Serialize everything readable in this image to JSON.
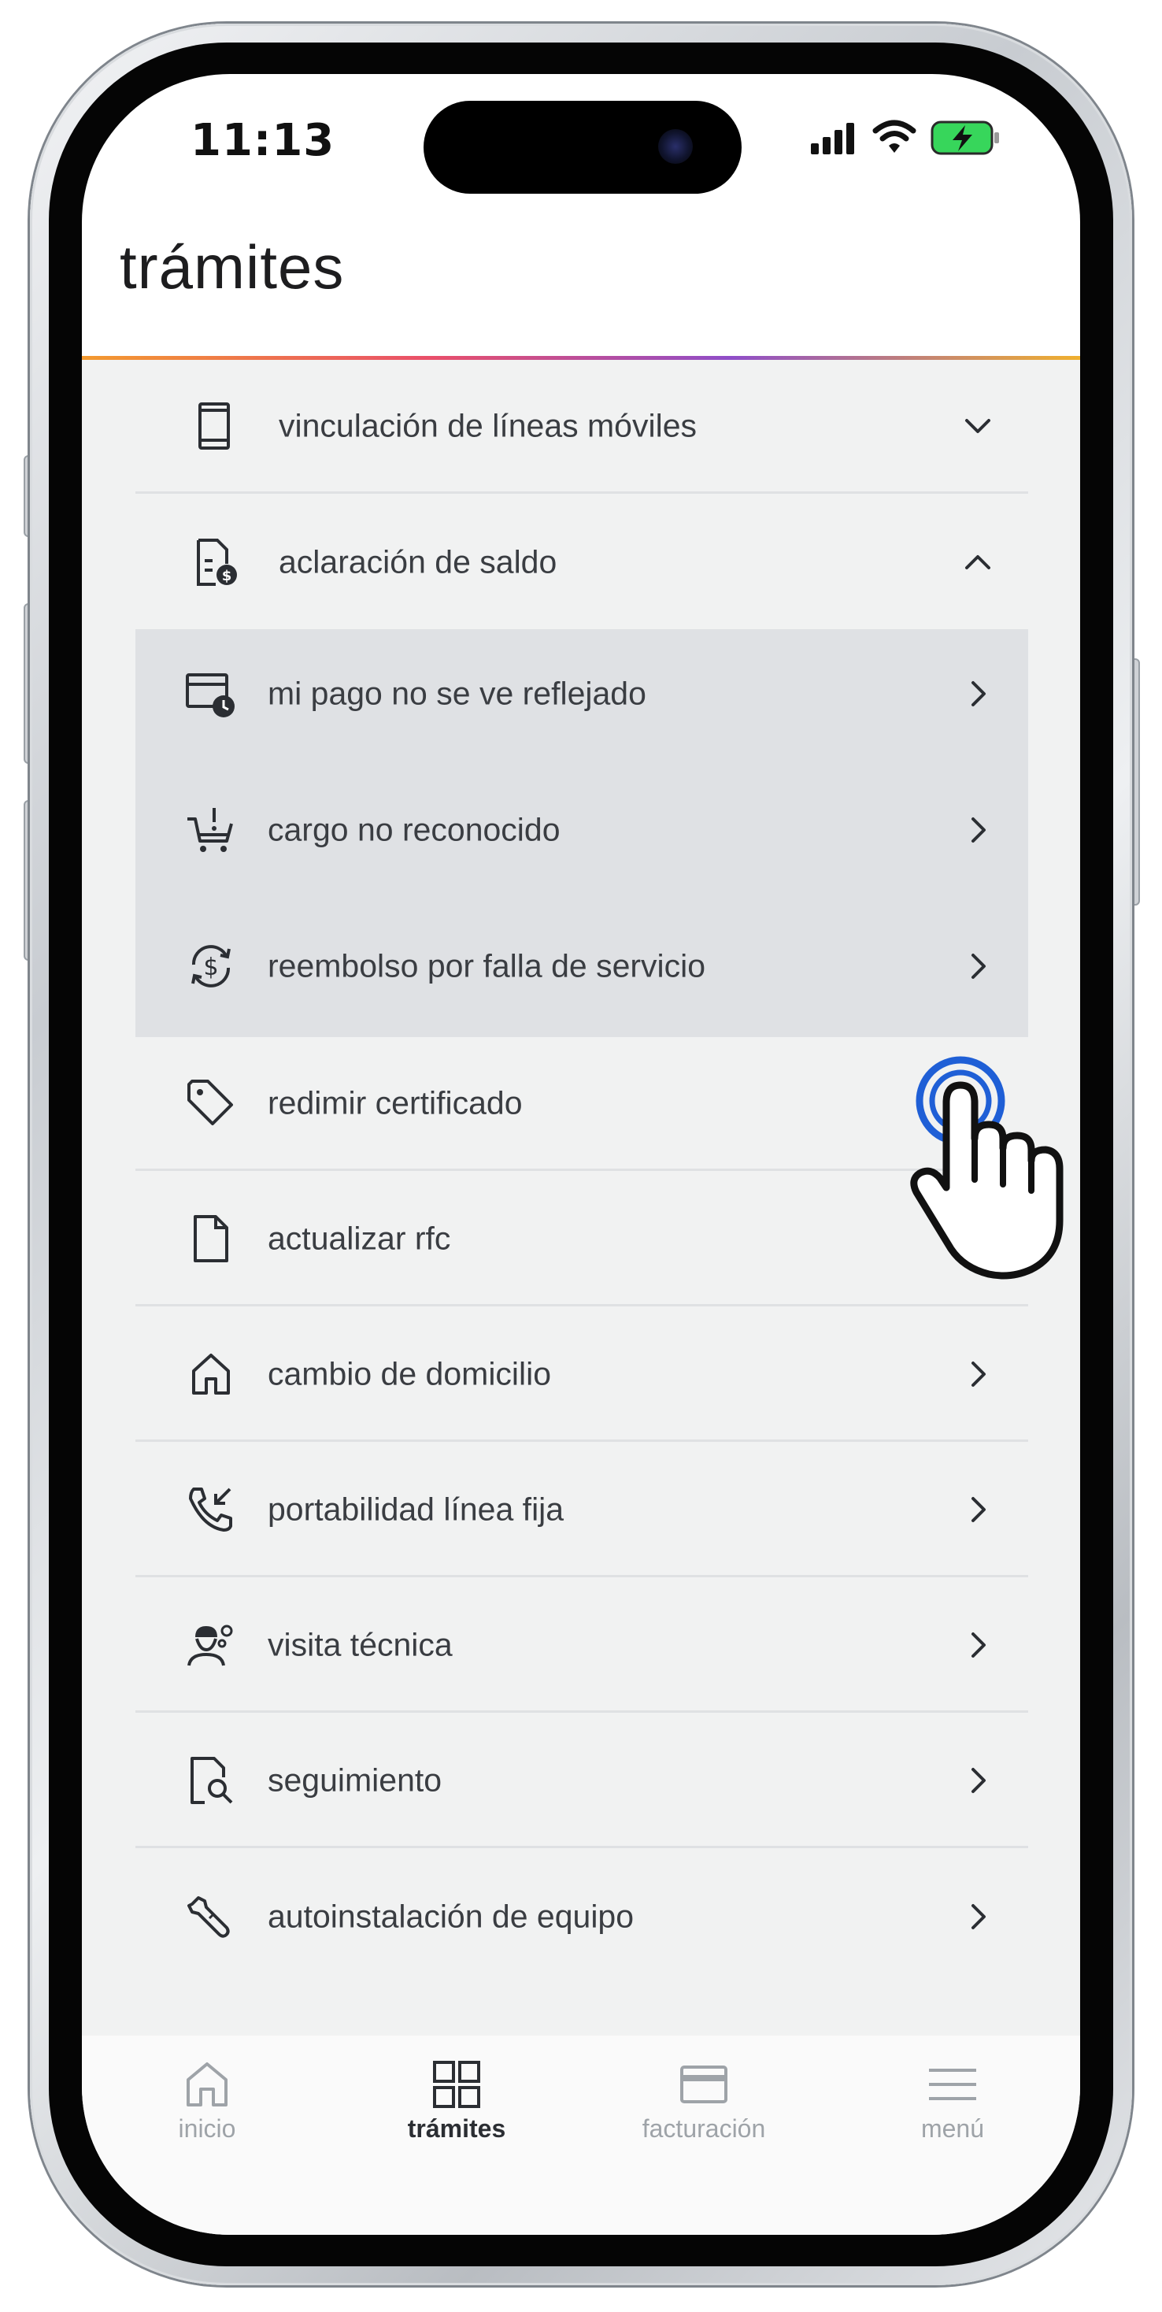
{
  "status_bar": {
    "time": "11:13"
  },
  "header": {
    "title": "trámites"
  },
  "menu": {
    "vinculacion": {
      "label": "vinculación de líneas móviles",
      "icon": "phone-device-icon",
      "expanded": false
    },
    "aclaracion": {
      "label": "aclaración de saldo",
      "icon": "document-dollar-icon",
      "expanded": true
    },
    "sub_items": [
      {
        "label": "mi pago no se ve reflejado",
        "icon": "card-clock-icon"
      },
      {
        "label": "cargo no reconocido",
        "icon": "cart-alert-icon"
      },
      {
        "label": "reembolso por falla de servicio",
        "icon": "refund-dollar-icon"
      }
    ],
    "items": [
      {
        "label": "redimir certificado",
        "icon": "tag-icon"
      },
      {
        "label": "actualizar rfc",
        "icon": "file-icon"
      },
      {
        "label": "cambio de domicilio",
        "icon": "home-icon"
      },
      {
        "label": "portabilidad línea fija",
        "icon": "phone-incoming-icon"
      },
      {
        "label": "visita técnica",
        "icon": "technician-icon"
      },
      {
        "label": "seguimiento",
        "icon": "document-search-icon"
      },
      {
        "label": "autoinstalación de equipo",
        "icon": "wrench-icon"
      }
    ]
  },
  "bottom_nav": [
    {
      "label": "inicio",
      "icon": "home-icon",
      "active": false
    },
    {
      "label": "trámites",
      "icon": "grid-icon",
      "active": true
    },
    {
      "label": "facturación",
      "icon": "card-icon",
      "active": false
    },
    {
      "label": "menú",
      "icon": "hamburger-icon",
      "active": false
    }
  ],
  "colors": {
    "accent_blue": "#1f5fd6",
    "submenu_bg": "#dfe1e4",
    "content_bg": "#f1f2f2"
  }
}
